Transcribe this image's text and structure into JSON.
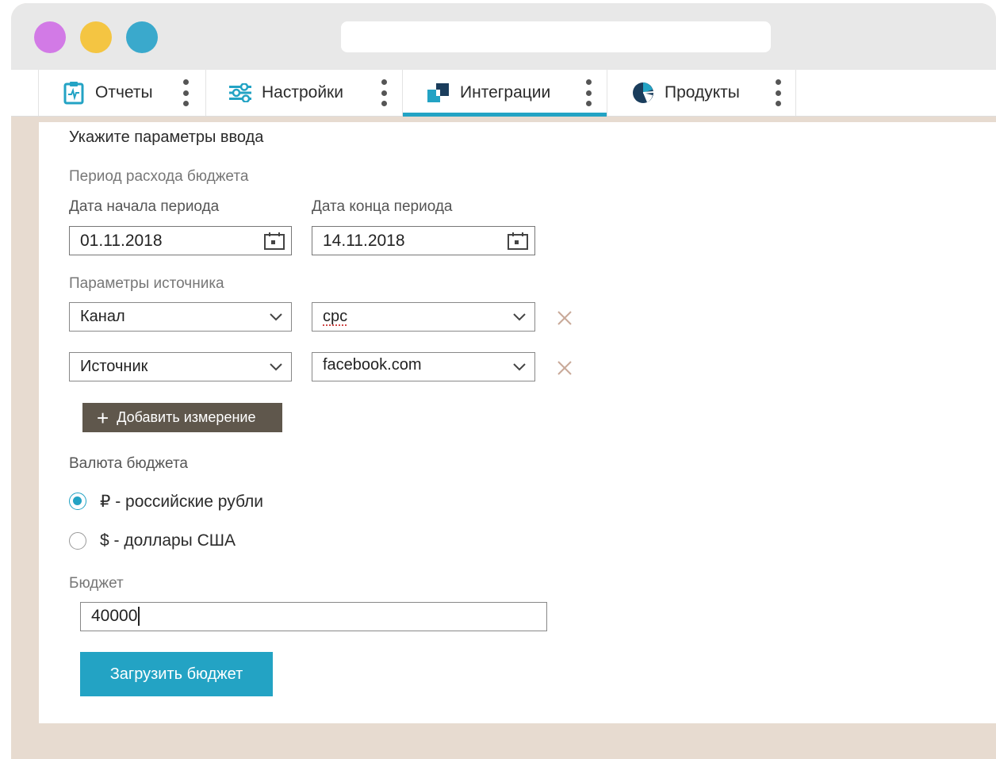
{
  "window": {
    "traffic_lights": [
      "#d27ae6",
      "#f4c542",
      "#3aa9cc"
    ],
    "url": ""
  },
  "tabs": [
    {
      "label": "Отчеты",
      "icon": "clipboard-chart-icon",
      "active": false
    },
    {
      "label": "Настройки",
      "icon": "sliders-icon",
      "active": false
    },
    {
      "label": "Интеграции",
      "icon": "integration-squares-icon",
      "active": true
    },
    {
      "label": "Продукты",
      "icon": "pie-chart-icon",
      "active": false
    }
  ],
  "form": {
    "title": "Укажите параметры ввода",
    "period_section": "Период расхода бюджета",
    "start_label": "Дата начала периода",
    "start_value": "01.11.2018",
    "end_label": "Дата конца периода",
    "end_value": "14.11.2018",
    "source_section": "Параметры источника",
    "rows": [
      {
        "dimension": "Канал",
        "value": "cpc"
      },
      {
        "dimension": "Источник",
        "value": "facebook.com"
      }
    ],
    "add_dimension": "Добавить измерение",
    "currency_section": "Валюта бюджета",
    "currency_options": [
      {
        "label": "₽ - российские рубли",
        "checked": true
      },
      {
        "label": "$ - доллары США",
        "checked": false
      }
    ],
    "budget_label": "Бюджет",
    "budget_value": "40000",
    "submit": "Загрузить бюджет"
  },
  "colors": {
    "accent": "#23a3c4",
    "dark_button": "#5f574c",
    "page_background": "#e7dbd0"
  }
}
